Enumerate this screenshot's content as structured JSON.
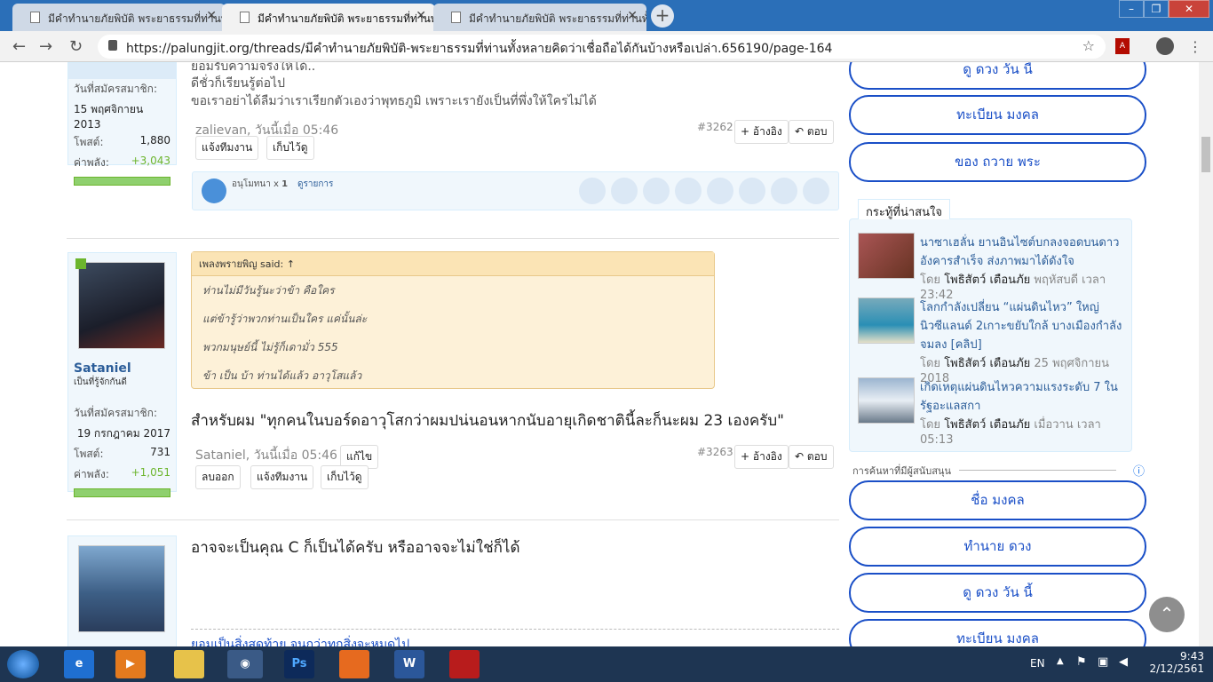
{
  "browser": {
    "tabs": [
      {
        "title": "มีคำทำนายภัยพิบัติ พระยาธรรมที่ท่านทั้งหลาย"
      },
      {
        "title": "มีคำทำนายภัยพิบัติ พระยาธรรมที่ท่านทั้งหลาย"
      },
      {
        "title": "มีคำทำนายภัยพิบัติ พระยาธรรมที่ท่านทั้งหลาย"
      }
    ],
    "new_tab": "+",
    "url": "https://palungjit.org/threads/มีคำทำนายภัยพิบัติ-พระยาธรรมที่ท่านทั้งหลายคิดว่าเชื่อถือได้กันบ้างหรือเปล่า.656190/page-164"
  },
  "posts": [
    {
      "user": {
        "joined_label": "วันที่สมัครสมาชิก:",
        "joined": "15 พฤศจิกายน 2013",
        "posts_label": "โพสต์:",
        "posts": "1,880",
        "power_label": "ค่าพลัง:",
        "power": "+3,043"
      },
      "lines": [
        "ยอมรับความจริงให้ได้..",
        "ดีชั่วก็เรียนรู้ต่อไป",
        "ขอเราอย่าได้ลืมว่าเราเรียกตัวเองว่าพุทธภูมิ เพราะเรายังเป็นที่พึ่งให้ใครไม่ได้"
      ],
      "meta": "zalievan, วันนี้เมื่อ 05:46",
      "number": "#3262",
      "quote_btn": "+ อ้างอิง",
      "reply_btn": "ตอบ",
      "report_btn": "แจ้งทีมงาน",
      "save_btn": "เก็บไว้ดู",
      "likes_text": "อนุโมทนา x",
      "likes_count": "1",
      "likes_list": "ดูรายการ"
    },
    {
      "user": {
        "name": "Sataniel",
        "title": "เป็นที่รู้จักกันดี",
        "joined_label": "วันที่สมัครสมาชิก:",
        "joined": "19 กรกฎาคม 2017",
        "posts_label": "โพสต์:",
        "posts": "731",
        "power_label": "ค่าพลัง:",
        "power": "+1,051"
      },
      "quote_head": "เพลงพรายพิญ said: ↑",
      "quote_lines": [
        "ท่านไม่มีวันรู้นะว่าข้า คือใคร",
        "แต่ข้ารู้ว่าพวกท่านเป็นใคร แค่นั้นล่ะ",
        "พวกมนุษย์นี้ ไม่รู้ก็เดามั่ว 555",
        "ข้า เป็น บ้า ท่านได้แล้ว อาวุโสแล้ว"
      ],
      "message": "สำหรับผม \"ทุกคนในบอร์ดอาวุโสกว่าผมปน่นอนหากนับอายุเกิดชาตินี้ละก็นะผม 23 เองครับ\"",
      "meta": "Sataniel, วันนี้เมื่อ 05:46",
      "edit_btn": "แก้ไข",
      "number": "#3263",
      "quote_btn": "+ อ้างอิง",
      "reply_btn": "ตอบ",
      "delete_btn": "ลบออก",
      "report_btn": "แจ้งทีมงาน",
      "save_btn": "เก็บไว้ดู"
    },
    {
      "message": "อาจจะเป็นคุณ C ก็เป็นได้ครับ หรืออาจจะไม่ใช่ก็ได้",
      "signature": "ยอมเป็นสิ่งสุดท้าย จนกว่าทุกสิ่งจะหมดไป"
    }
  ],
  "sidebar": {
    "top_buttons": [
      "ดู ดวง วัน นี้",
      "ทะเบียน มงคล",
      "ของ ถวาย พระ"
    ],
    "threads_title": "กระทู้ที่น่าสนใจ",
    "threads": [
      {
        "title": "นาซาเฮลั่น ยานอินไซต์บกลงจอดบนดาวอังคารสำเร็จ ส่งภาพมาได้ดังใจ",
        "by": "โดย",
        "author": "โพธิสัตว์ เตือนภัย",
        "time": "พฤหัสบดี เวลา 23:42"
      },
      {
        "title": "โลกกำลังเปลี่ยน “แผ่นดินไหว” ใหญ่ นิวซีแลนด์ 2เกาะขยับใกล้ บางเมืองกำลังจมลง [คลิป]",
        "by": "โดย",
        "author": "โพธิสัตว์ เตือนภัย",
        "time": "25 พฤศจิกายน 2018"
      },
      {
        "title": "เกิดเหตุแผ่นดินไหวความแรงระดับ 7 ในรัฐอะแลสกา",
        "by": "โดย",
        "author": "โพธิสัตว์ เตือนภัย",
        "time": "เมื่อวาน เวลา 05:13"
      }
    ],
    "ads_label": "การค้นหาที่มีผู้สนับสนุน",
    "ad_buttons": [
      "ชื่อ มงคล",
      "ทำนาย ดวง",
      "ดู ดวง วัน นี้",
      "ทะเบียน มงคล"
    ]
  },
  "taskbar": {
    "lang": "EN",
    "time": "9:43",
    "date": "2/12/2561"
  },
  "colors": {
    "accent": "#1a4fc7",
    "link": "#2b5d99",
    "power": "#6cb52d",
    "quote_bg": "#fdf1d8"
  }
}
